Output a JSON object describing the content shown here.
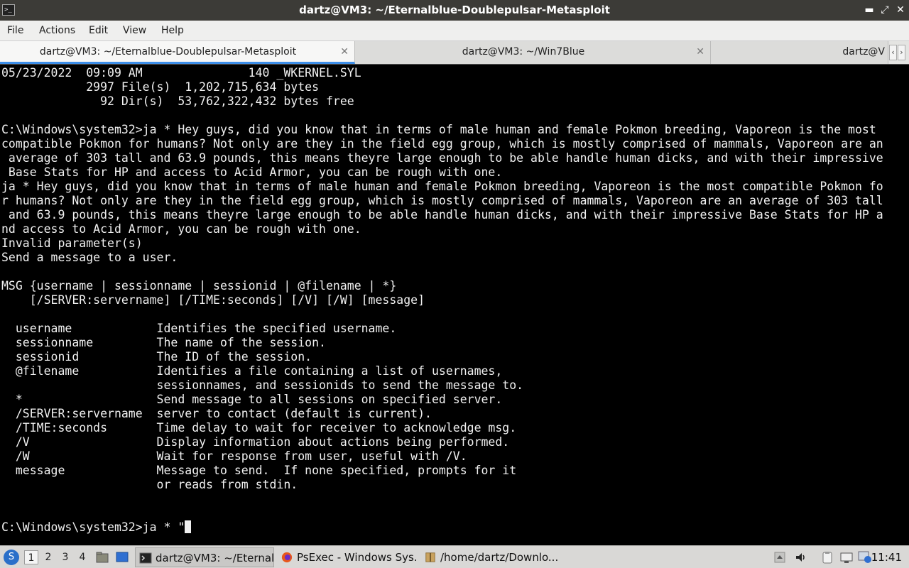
{
  "window": {
    "title": "dartz@VM3: ~/Eternalblue-Doublepulsar-Metasploit",
    "minimize": "▬",
    "maximize": "⤢",
    "close": "✕"
  },
  "menu": [
    "File",
    "Actions",
    "Edit",
    "View",
    "Help"
  ],
  "tabs": [
    {
      "label": "dartz@VM3: ~/Eternalblue-Doublepulsar-Metasploit",
      "close": "✕"
    },
    {
      "label": "dartz@VM3: ~/Win7Blue",
      "close": "✕"
    },
    {
      "label": "dartz@V"
    }
  ],
  "tab_arrows": {
    "left": "‹",
    "right": "›"
  },
  "terminal": {
    "output": "05/23/2022  09:09 AM               140 _WKERNEL.SYL\n            2997 File(s)  1,202,715,634 bytes\n              92 Dir(s)  53,762,322,432 bytes free\n\nC:\\Windows\\system32>ja * Hey guys, did you know that in terms of male human and female Pokmon breeding, Vaporeon is the most \ncompatible Pokmon for humans? Not only are they in the field egg group, which is mostly comprised of mammals, Vaporeon are an\n average of 303 tall and 63.9 pounds, this means theyre large enough to be able handle human dicks, and with their impressive\n Base Stats for HP and access to Acid Armor, you can be rough with one.\nja * Hey guys, did you know that in terms of male human and female Pokmon breeding, Vaporeon is the most compatible Pokmon fo\nr humans? Not only are they in the field egg group, which is mostly comprised of mammals, Vaporeon are an average of 303 tall\n and 63.9 pounds, this means theyre large enough to be able handle human dicks, and with their impressive Base Stats for HP a\nnd access to Acid Armor, you can be rough with one.\nInvalid parameter(s)\nSend a message to a user.\n\nMSG {username | sessionname | sessionid | @filename | *}\n    [/SERVER:servername] [/TIME:seconds] [/V] [/W] [message]\n\n  username            Identifies the specified username.\n  sessionname         The name of the session.\n  sessionid           The ID of the session.\n  @filename           Identifies a file containing a list of usernames,\n                      sessionnames, and sessionids to send the message to.\n  *                   Send message to all sessions on specified server.\n  /SERVER:servername  server to contact (default is current).\n  /TIME:seconds       Time delay to wait for receiver to acknowledge msg.\n  /V                  Display information about actions being performed.\n  /W                  Wait for response from user, useful with /V.\n  message             Message to send.  If none specified, prompts for it\n                      or reads from stdin.\n\n\nC:\\Windows\\system32>ja * \""
  },
  "taskbar": {
    "start_glyph": "S",
    "desktops": [
      "1",
      "2",
      "3",
      "4"
    ],
    "tasks": [
      {
        "label": "dartz@VM3: ~/Eternal..."
      },
      {
        "label": "PsExec - Windows Sys..."
      },
      {
        "label": "/home/dartz/Downlo..."
      }
    ],
    "clock": "11:41"
  },
  "colors": {
    "terminal_bg": "#000000",
    "terminal_fg": "#f0f0f0",
    "titlebar": "#3c3b37",
    "tab_accent": "#3d8ee8"
  }
}
